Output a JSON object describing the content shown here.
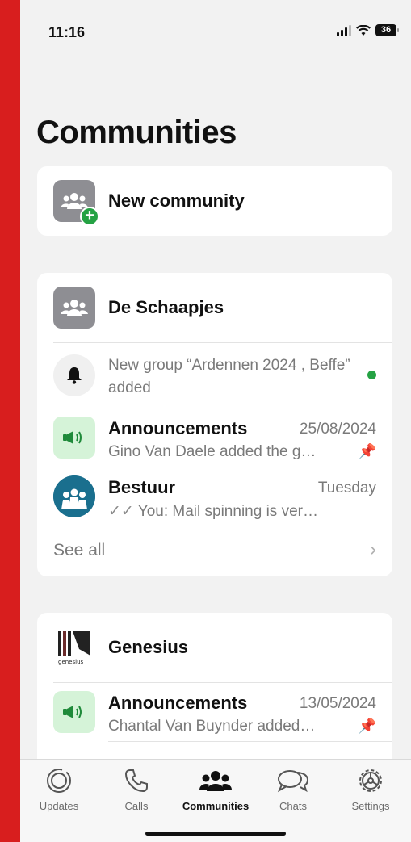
{
  "status": {
    "time": "11:16",
    "battery": "36"
  },
  "page": {
    "title": "Communities"
  },
  "new_community": {
    "label": "New community"
  },
  "communities": [
    {
      "name": "De Schaapjes",
      "notification": {
        "text": "New group “Ardennen 2024 , Beffe” added"
      },
      "items": [
        {
          "title": "Announcements",
          "date": "25/08/2024",
          "subtitle": "Gino Van Daele added the g…"
        },
        {
          "title": "Bestuur",
          "date": "Tuesday",
          "subtitle_prefix": "You:",
          "subtitle": " Mail spinning is ver…"
        }
      ],
      "see_all": "See all"
    },
    {
      "name": "Genesius",
      "items": [
        {
          "title": "Announcements",
          "date": "13/05/2024",
          "subtitle": "Chantal Van Buynder added…"
        }
      ]
    }
  ],
  "tabs": [
    {
      "label": "Updates",
      "icon": "updates-icon"
    },
    {
      "label": "Calls",
      "icon": "phone-icon"
    },
    {
      "label": "Communities",
      "icon": "communities-icon",
      "active": true
    },
    {
      "label": "Chats",
      "icon": "chats-icon"
    },
    {
      "label": "Settings",
      "icon": "gear-icon"
    }
  ],
  "colors": {
    "accent": "#25a244",
    "background": "#f2f2f2",
    "frame": "#d81e1e"
  }
}
